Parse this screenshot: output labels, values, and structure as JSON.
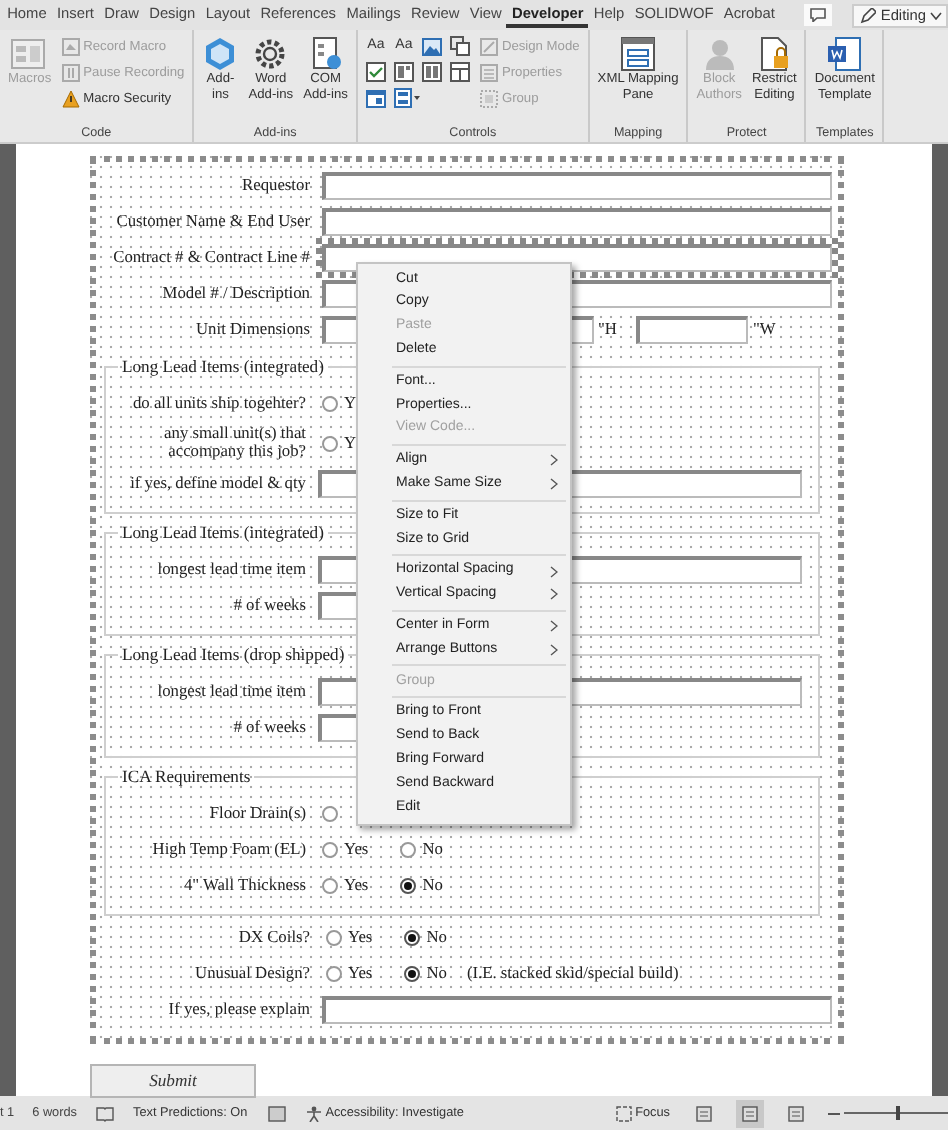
{
  "ribbon_tabs": [
    {
      "label": "Home",
      "selected": false
    },
    {
      "label": "Insert",
      "selected": false
    },
    {
      "label": "Draw",
      "selected": false
    },
    {
      "label": "Design",
      "selected": false
    },
    {
      "label": "Layout",
      "selected": false
    },
    {
      "label": "References",
      "selected": false
    },
    {
      "label": "Mailings",
      "selected": false
    },
    {
      "label": "Review",
      "selected": false
    },
    {
      "label": "View",
      "selected": false
    },
    {
      "label": "Developer",
      "selected": true
    },
    {
      "label": "Help",
      "selected": false
    },
    {
      "label": "SOLIDWOF",
      "selected": false
    },
    {
      "label": "Acrobat",
      "selected": false
    }
  ],
  "editing_button": {
    "label": "Editing"
  },
  "ribbon_groups": [
    {
      "label": "Code",
      "items": [
        {
          "kind": "large",
          "label": "Macros",
          "disabled": true
        },
        {
          "kind": "small",
          "label": "Record Macro",
          "disabled": true
        },
        {
          "kind": "small",
          "label": "Pause Recording",
          "disabled": true
        },
        {
          "kind": "small",
          "label": "Macro Security",
          "disabled": false
        }
      ]
    },
    {
      "label": "Add-ins",
      "items": [
        {
          "kind": "large",
          "label": "Add-\nins",
          "disabled": false
        },
        {
          "kind": "large",
          "label": "Word\nAdd-ins",
          "disabled": false
        },
        {
          "kind": "large",
          "label": "COM\nAdd-ins",
          "disabled": false
        }
      ]
    },
    {
      "label": "Controls",
      "items": [
        {
          "kind": "tool",
          "label": "Aa",
          "disabled": false
        },
        {
          "kind": "tool",
          "label": "Aa",
          "disabled": false
        },
        {
          "kind": "tool",
          "disabled": false
        },
        {
          "kind": "tool",
          "disabled": false
        },
        {
          "kind": "tool",
          "disabled": false
        },
        {
          "kind": "tool",
          "disabled": false
        },
        {
          "kind": "tool",
          "disabled": false
        },
        {
          "kind": "tool",
          "disabled": false
        },
        {
          "kind": "tool",
          "disabled": false
        },
        {
          "kind": "tool",
          "disabled": false
        },
        {
          "kind": "small",
          "label": "Design Mode",
          "disabled": true
        },
        {
          "kind": "small",
          "label": "Properties",
          "disabled": true
        },
        {
          "kind": "small",
          "label": "Group",
          "disabled": true
        }
      ]
    },
    {
      "label": "Mapping",
      "items": [
        {
          "kind": "large",
          "label": "XML Mapping\nPane",
          "disabled": false
        }
      ]
    },
    {
      "label": "Protect",
      "items": [
        {
          "kind": "large",
          "label": "Block\nAuthors",
          "disabled": true
        },
        {
          "kind": "large",
          "label": "Restrict\nEditing",
          "disabled": false
        }
      ]
    },
    {
      "label": "Templates",
      "items": [
        {
          "kind": "large",
          "label": "Document\nTemplate",
          "disabled": false
        }
      ]
    }
  ],
  "form": {
    "rows": [
      {
        "kind": "text",
        "label": "Requestor",
        "selected": false
      },
      {
        "kind": "text",
        "label": "Customer Name & End User",
        "selected": false
      },
      {
        "kind": "text",
        "label": "Contract # & Contract Line #",
        "selected": true
      },
      {
        "kind": "text",
        "label": "Model # / Description",
        "selected": false
      },
      {
        "kind": "dimensions",
        "label": "Unit Dimensions",
        "units": [
          "\"H",
          "\"W"
        ]
      },
      {
        "kind": "group",
        "legend": "Long Lead Items (integrated)",
        "rows": [
          {
            "kind": "radio",
            "label": "do all units ship togehter?",
            "options": [
              {
                "label": "Y",
                "selected": false
              }
            ]
          },
          {
            "kind": "radio",
            "label": "any small unit(s) that\naccompany this job?",
            "options": [
              {
                "label": "Y",
                "selected": false
              }
            ]
          },
          {
            "kind": "text",
            "label": "if yes, define model & qty",
            "selected": false
          }
        ]
      },
      {
        "kind": "group",
        "legend": "Long Lead Items (integrated)",
        "rows": [
          {
            "kind": "text",
            "label": "longest lead time item",
            "selected": false
          },
          {
            "kind": "short",
            "label": "# of weeks",
            "selected": false
          }
        ]
      },
      {
        "kind": "group",
        "legend": "Long Lead Items (drop shipped)",
        "rows": [
          {
            "kind": "text",
            "label": "longest lead time item",
            "selected": false
          },
          {
            "kind": "short",
            "label": "# of weeks",
            "selected": false
          }
        ]
      },
      {
        "kind": "group",
        "legend": "ICA Requirements",
        "rows": [
          {
            "kind": "radio",
            "label": "Floor Drain(s)",
            "options": [
              {
                "selected": false
              }
            ]
          },
          {
            "kind": "radio",
            "label": "High Temp Foam (EL)",
            "options": [
              {
                "label": "Yes",
                "selected": false
              },
              {
                "label": "No",
                "selected": false
              }
            ]
          },
          {
            "kind": "radio",
            "label": "4\" Wall Thickness",
            "options": [
              {
                "label": "Yes",
                "selected": false
              },
              {
                "label": "No",
                "selected": true
              }
            ]
          }
        ]
      },
      {
        "kind": "radio",
        "label": "DX Coils?",
        "options": [
          {
            "label": "Yes",
            "selected": false
          },
          {
            "label": "No",
            "selected": true
          }
        ]
      },
      {
        "kind": "radio",
        "label": "Unusual Design?",
        "options": [
          {
            "label": "Yes",
            "selected": false
          },
          {
            "label": "No",
            "selected": true
          }
        ],
        "note": "(I.E. stacked skid/special build)"
      },
      {
        "kind": "text",
        "label": "If yes, please explain",
        "selected": false
      }
    ],
    "submit": "Submit"
  },
  "context_menu": {
    "sections": [
      {
        "items": [
          {
            "label": "Cut",
            "disabled": false,
            "submenu": false
          },
          {
            "label": "Copy",
            "disabled": false,
            "submenu": false
          },
          {
            "label": "Paste",
            "disabled": true,
            "submenu": false
          },
          {
            "label": "Delete",
            "disabled": false,
            "submenu": false
          }
        ]
      },
      {
        "items": [
          {
            "label": "Font...",
            "disabled": false,
            "submenu": false
          },
          {
            "label": "Properties...",
            "disabled": false,
            "submenu": false
          },
          {
            "label": "View Code...",
            "disabled": true,
            "submenu": false
          }
        ]
      },
      {
        "items": [
          {
            "label": "Align",
            "disabled": false,
            "submenu": true
          },
          {
            "label": "Make Same Size",
            "disabled": false,
            "submenu": true
          }
        ]
      },
      {
        "items": [
          {
            "label": "Size to Fit",
            "disabled": false,
            "submenu": false
          },
          {
            "label": "Size to Grid",
            "disabled": false,
            "submenu": false
          }
        ]
      },
      {
        "items": [
          {
            "label": "Horizontal Spacing",
            "disabled": false,
            "submenu": true
          },
          {
            "label": "Vertical Spacing",
            "disabled": false,
            "submenu": true
          }
        ]
      },
      {
        "items": [
          {
            "label": "Center in Form",
            "disabled": false,
            "submenu": true
          },
          {
            "label": "Arrange Buttons",
            "disabled": false,
            "submenu": true
          }
        ]
      },
      {
        "items": [
          {
            "label": "Group",
            "disabled": true,
            "submenu": false
          }
        ]
      },
      {
        "items": [
          {
            "label": "Bring to Front",
            "disabled": false,
            "submenu": false
          },
          {
            "label": "Send to Back",
            "disabled": false,
            "submenu": false
          },
          {
            "label": "Bring Forward",
            "disabled": false,
            "submenu": false
          },
          {
            "label": "Send Backward",
            "disabled": false,
            "submenu": false
          },
          {
            "label": "Edit",
            "disabled": false,
            "submenu": false
          }
        ]
      }
    ]
  },
  "status_bar": {
    "page": "t 1",
    "words": "6 words",
    "predictions": "Text Predictions: On",
    "accessibility": "Accessibility: Investigate",
    "focus": "Focus",
    "views": [
      {
        "selected": false
      },
      {
        "selected": true
      },
      {
        "selected": false
      }
    ],
    "zoom": {
      "level": 0.5
    }
  }
}
